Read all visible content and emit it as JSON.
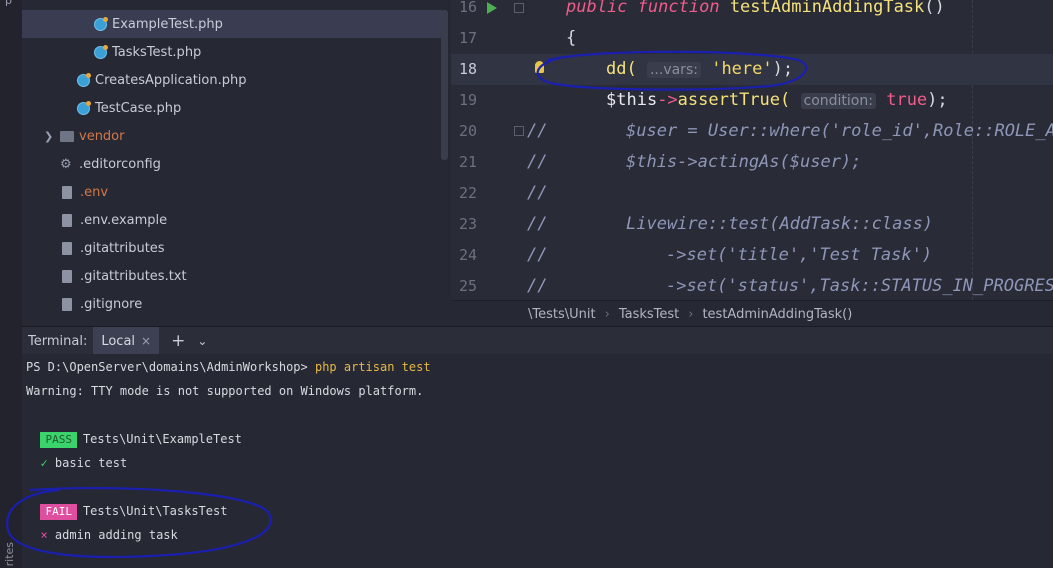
{
  "left_strip": {
    "top_fragment": "p",
    "bottom_fragment": "rites"
  },
  "tree": {
    "items": [
      {
        "label": "ExampleTest.php",
        "kind": "php",
        "selected": true
      },
      {
        "label": "TasksTest.php",
        "kind": "php",
        "selected": false
      },
      {
        "label": "CreatesApplication.php",
        "kind": "php",
        "selected": false
      },
      {
        "label": "TestCase.php",
        "kind": "php",
        "selected": false
      },
      {
        "label": "vendor",
        "kind": "folder",
        "selected": false
      },
      {
        "label": ".editorconfig",
        "kind": "config",
        "selected": false
      },
      {
        "label": ".env",
        "kind": "env",
        "selected": false
      },
      {
        "label": ".env.example",
        "kind": "file",
        "selected": false
      },
      {
        "label": ".gitattributes",
        "kind": "file",
        "selected": false
      },
      {
        "label": ".gitattributes.txt",
        "kind": "file",
        "selected": false
      },
      {
        "label": ".gitignore",
        "kind": "file",
        "selected": false
      }
    ]
  },
  "editor": {
    "lines": [
      {
        "num": "16"
      },
      {
        "num": "17"
      },
      {
        "num": "18"
      },
      {
        "num": "19"
      },
      {
        "num": "20"
      },
      {
        "num": "21"
      },
      {
        "num": "22"
      },
      {
        "num": "23"
      },
      {
        "num": "24"
      },
      {
        "num": "25"
      }
    ],
    "l16": {
      "kw1": "public",
      "kw2": "function",
      "name": "testAdminAddingTask",
      "rest": "()"
    },
    "l17": {
      "text": "{"
    },
    "l18": {
      "fn": "dd(",
      "hint": "...vars:",
      "str": "'here'",
      "end": ");"
    },
    "l19": {
      "var": "$this",
      "arrow": "->",
      "fn": "assertTrue(",
      "hint": "condition:",
      "val": "true",
      "end": ");"
    },
    "comment_mark": "//",
    "l20": {
      "text": "$user = User::where('role_id',Role::ROLE_AD"
    },
    "l21": {
      "text": "$this->actingAs($user);"
    },
    "l22": {
      "text": ""
    },
    "l23": {
      "text": "Livewire::test(AddTask::class)"
    },
    "l24": {
      "text": "->set('title','Test Task')"
    },
    "l25": {
      "text": "->set('status',Task::STATUS_IN_PROGRESS"
    }
  },
  "breadcrumb": {
    "items": [
      "\\Tests\\Unit",
      "TasksTest",
      "testAdminAddingTask()"
    ],
    "sep": "›"
  },
  "terminal": {
    "label": "Terminal:",
    "tab": "Local",
    "tab_close": "×",
    "plus": "+",
    "chevron": "⌄",
    "prompt": "PS D:\\OpenServer\\domains\\AdminWorkshop> ",
    "command": "php artisan test",
    "warning": "Warning: TTY mode is not supported on Windows platform.",
    "pass_badge": "PASS",
    "pass_name": "Tests\\Unit\\ExampleTest",
    "pass_mark": "✓",
    "pass_test": "basic test",
    "fail_badge": "FAIL",
    "fail_name": "Tests\\Unit\\TasksTest",
    "fail_mark": "×",
    "fail_test": "admin adding task"
  },
  "colors": {
    "accent_pass": "#3bd36c",
    "accent_fail": "#e04ea0",
    "annotation": "#1a1fb0"
  }
}
